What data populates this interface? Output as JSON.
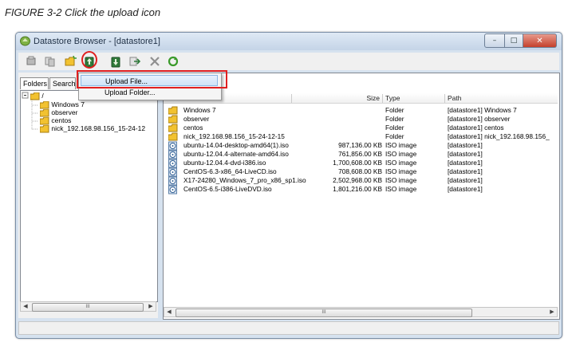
{
  "caption": "FIGURE 3-2  Click the upload icon",
  "window": {
    "title": "Datastore Browser - [datastore1]"
  },
  "window_controls": {
    "minimize": "–",
    "maximize": "□",
    "close": "✕"
  },
  "toolbar": {
    "icons": [
      "browse-datastore-icon",
      "copy-icon",
      "new-folder-icon",
      "upload-icon",
      "download-icon",
      "move-icon",
      "delete-icon",
      "refresh-icon"
    ]
  },
  "left_pane": {
    "tabs": [
      "Folders",
      "Search"
    ],
    "tree_root": "/",
    "tree_items": [
      "Windows 7",
      "observer",
      "centos",
      "nick_192.168.98.156_15-24-12"
    ]
  },
  "upload_menu": {
    "items": [
      "Upload File...",
      "Upload Folder..."
    ],
    "highlighted": "Upload File..."
  },
  "file_table": {
    "columns": {
      "size": "Size",
      "type": "Type",
      "path": "Path"
    },
    "rows": [
      {
        "name": "Windows 7",
        "size": "",
        "type": "Folder",
        "path": "[datastore1] Windows 7",
        "icon": "folder-icon"
      },
      {
        "name": "observer",
        "size": "",
        "type": "Folder",
        "path": "[datastore1] observer",
        "icon": "folder-icon"
      },
      {
        "name": "centos",
        "size": "",
        "type": "Folder",
        "path": "[datastore1] centos",
        "icon": "folder-icon"
      },
      {
        "name": "nick_192.168.98.156_15-24-12-15",
        "size": "",
        "type": "Folder",
        "path": "[datastore1] nick_192.168.98.156_",
        "icon": "folder-icon"
      },
      {
        "name": "ubuntu-14.04-desktop-amd64(1).iso",
        "size": "987,136.00 KB",
        "type": "ISO image",
        "path": "[datastore1]",
        "icon": "disc-icon"
      },
      {
        "name": "ubuntu-12.04.4-alternate-amd64.iso",
        "size": "761,856.00 KB",
        "type": "ISO image",
        "path": "[datastore1]",
        "icon": "disc-icon"
      },
      {
        "name": "ubuntu-12.04.4-dvd-i386.iso",
        "size": "1,700,608.00 KB",
        "type": "ISO image",
        "path": "[datastore1]",
        "icon": "disc-icon"
      },
      {
        "name": "CentOS-6.3-x86_64-LiveCD.iso",
        "size": "708,608.00 KB",
        "type": "ISO image",
        "path": "[datastore1]",
        "icon": "disc-icon"
      },
      {
        "name": "X17-24280_Windows_7_pro_x86_sp1.iso",
        "size": "2,502,968.00 KB",
        "type": "ISO image",
        "path": "[datastore1]",
        "icon": "disc-icon"
      },
      {
        "name": "CentOS-6.5-i386-LiveDVD.iso",
        "size": "1,801,216.00 KB",
        "type": "ISO image",
        "path": "[datastore1]",
        "icon": "disc-icon"
      }
    ]
  },
  "scrollbar": {
    "grip": "III",
    "left_arrow": "◀",
    "right_arrow": "▶"
  },
  "colors": {
    "highlight_red": "#e02020",
    "folder_yellow": "#f2c230",
    "selection_blue": "#cfe3f7"
  }
}
